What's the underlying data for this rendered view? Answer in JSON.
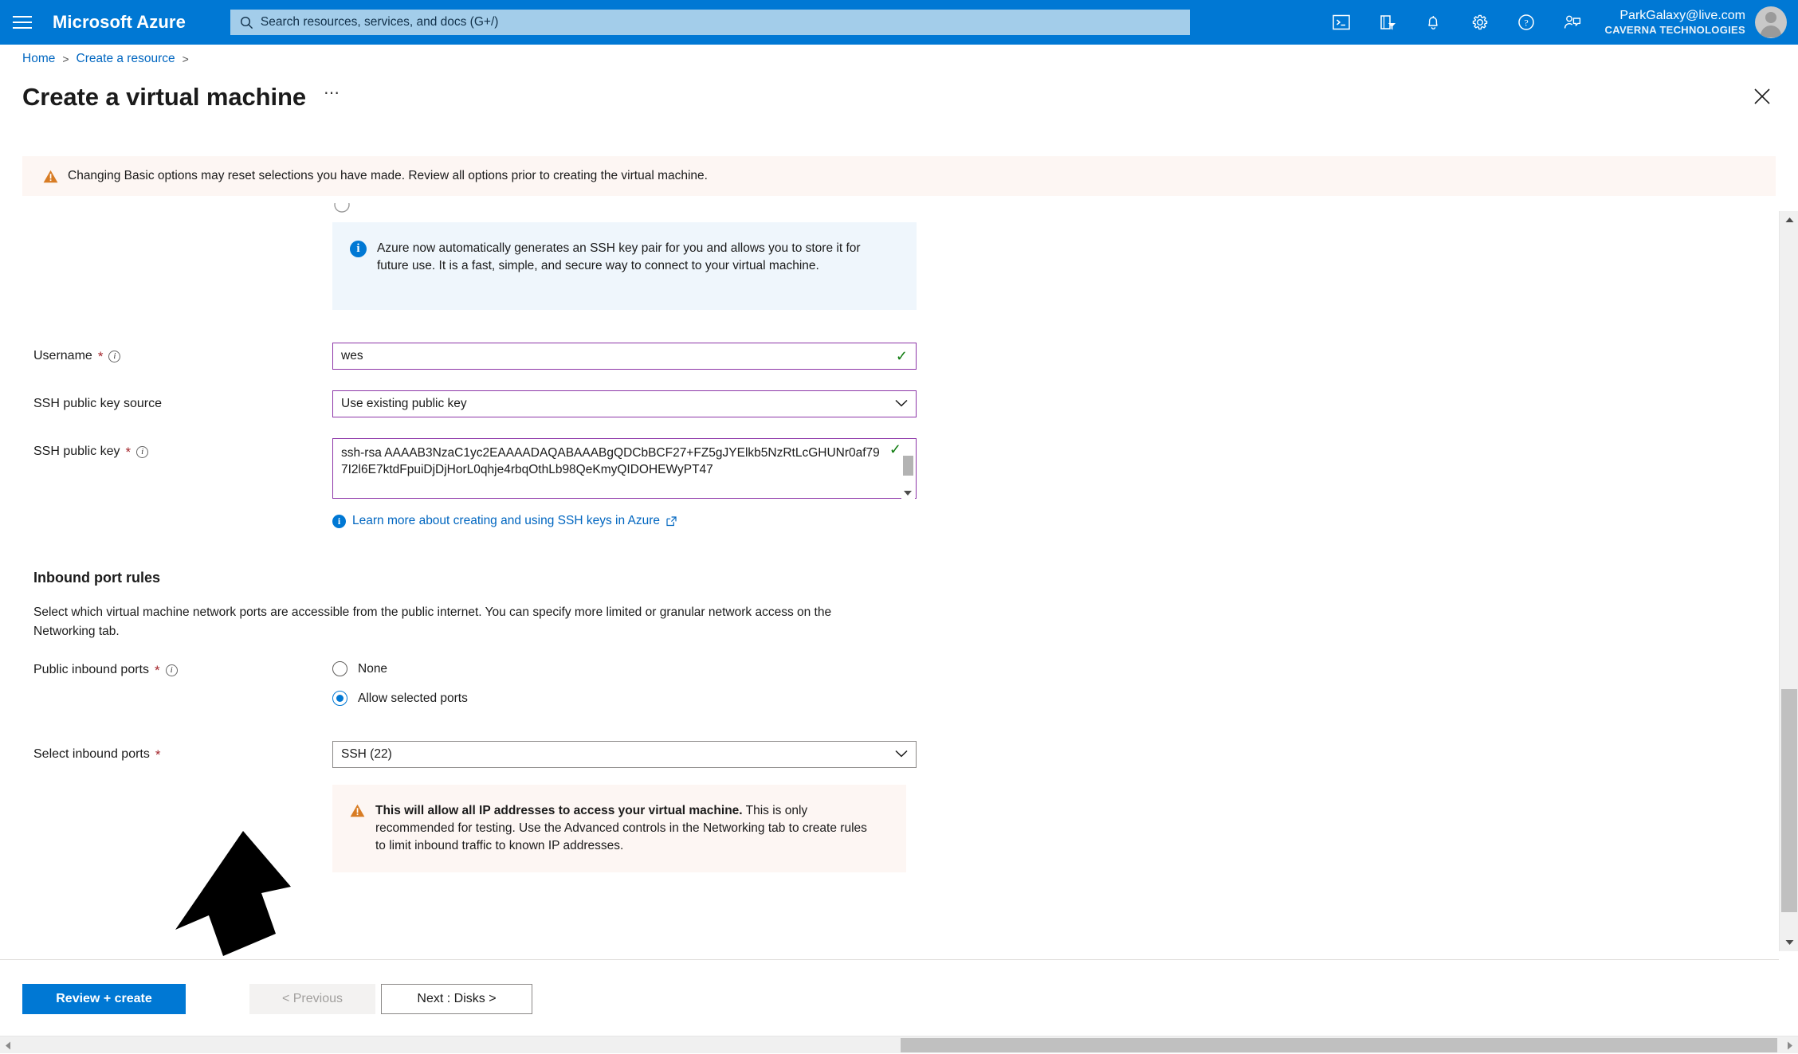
{
  "topnav": {
    "menu_icon": "hamburger-icon",
    "brand": "Microsoft Azure",
    "search_placeholder": "Search resources, services, and docs (G+/)",
    "search_icon": "search-icon",
    "icons": [
      {
        "name": "cloud-shell-icon",
        "title": "Cloud Shell"
      },
      {
        "name": "directories-subscriptions-icon",
        "title": "Directories + subscriptions"
      },
      {
        "name": "notifications-bell-icon",
        "title": "Notifications"
      },
      {
        "name": "settings-gear-icon",
        "title": "Settings"
      },
      {
        "name": "help-question-icon",
        "title": "Help"
      },
      {
        "name": "feedback-icon",
        "title": "Feedback"
      }
    ],
    "account_email": "ParkGalaxy@live.com",
    "account_org": "CAVERNA TECHNOLOGIES"
  },
  "breadcrumb": {
    "home": "Home",
    "create_resource": "Create a resource",
    "separator": ">"
  },
  "header": {
    "title": "Create a virtual machine",
    "more_label": "⋯",
    "close_icon": "close-icon"
  },
  "banner": {
    "icon": "warning-triangle-icon",
    "text": "Changing Basic options may reset selections you have made. Review all options prior to creating the virtual machine."
  },
  "ssh_info_box": {
    "icon": "info-circle-icon",
    "text": "Azure now automatically generates an SSH key pair for you and allows you to store it for future use. It is a fast, simple, and secure way to connect to your virtual machine."
  },
  "fields": {
    "username": {
      "label": "Username",
      "required_marker": "*",
      "info_icon": "info-icon",
      "value": "wes",
      "valid_icon": "✓"
    },
    "ssh_key_source": {
      "label": "SSH public key source",
      "value": "Use existing public key",
      "chevron": "chevron-down-icon"
    },
    "ssh_public_key": {
      "label": "SSH public key",
      "required_marker": "*",
      "info_icon": "info-icon",
      "value": "ssh-rsa AAAAB3NzaC1yc2EAAAADAQABAAABgQDCbBCF27+FZ5gJYElkb5NzRtLcGHUNr0af797I2l6E7ktdFpuiDjDjHorL0qhje4rbqOthLb98QeKmyQIDOHEWyPT47",
      "valid_icon": "✓"
    },
    "learn_more_link": "Learn more about creating and using SSH keys in Azure",
    "learn_more_external_icon": "external-link-icon"
  },
  "inbound_section": {
    "heading": "Inbound port rules",
    "description": "Select which virtual machine network ports are accessible from the public internet. You can specify more limited or granular network access on the Networking tab.",
    "public_ports": {
      "label": "Public inbound ports",
      "required_marker": "*",
      "info_icon": "info-icon",
      "options": [
        {
          "label": "None",
          "selected": false
        },
        {
          "label": "Allow selected ports",
          "selected": true
        }
      ]
    },
    "select_ports": {
      "label": "Select inbound ports",
      "required_marker": "*",
      "value": "SSH (22)",
      "chevron": "chevron-down-icon"
    },
    "warning": {
      "icon": "warning-triangle-icon",
      "bold_text": "This will allow all IP addresses to access your virtual machine.",
      "rest_text": "This is only recommended for testing.  Use the Advanced controls in the Networking tab to create rules to limit inbound traffic to known IP addresses."
    }
  },
  "footer": {
    "review_create": "Review + create",
    "previous": "< Previous",
    "next": "Next : Disks >"
  },
  "scrollbars": {
    "vertical_up_icon": "caret-up-icon",
    "vertical_down_icon": "caret-down-icon",
    "horizontal_left_icon": "caret-left-icon",
    "horizontal_right_icon": "caret-right-icon"
  },
  "annotation": {
    "arrow": "black-arrow-pointing-to-review-create"
  },
  "colors": {
    "azure_blue": "#0078d4",
    "link_blue": "#0066c0",
    "warn_bg": "#fdf6f3",
    "info_bg": "#eff6fc",
    "required_red": "#a4262c",
    "field_purple": "#8d36a8",
    "valid_green": "#107c10"
  }
}
